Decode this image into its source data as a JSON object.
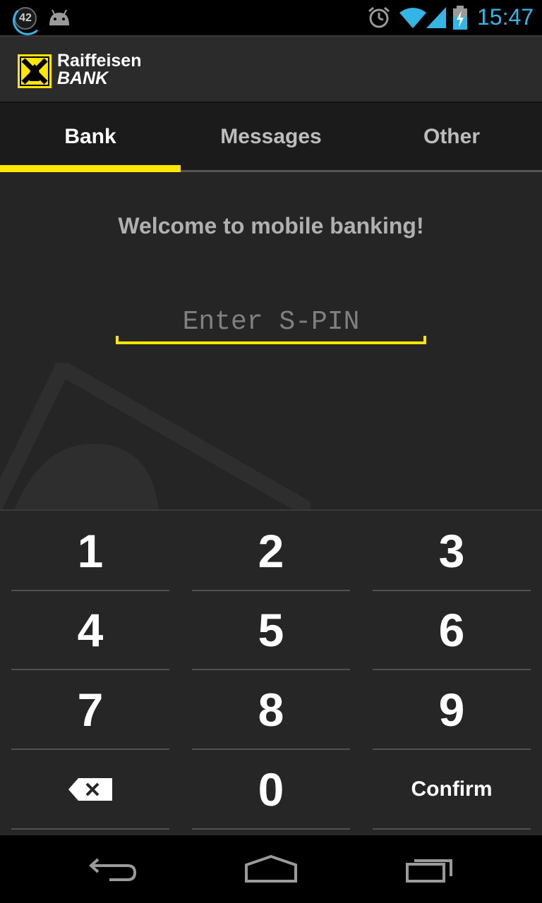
{
  "status_bar": {
    "notification_count": "42",
    "time": "15:47",
    "icons": [
      "android-icon",
      "alarm-icon",
      "wifi-icon",
      "signal-icon",
      "battery-charging-icon"
    ]
  },
  "app_bar": {
    "logo_line1": "Raiffeisen",
    "logo_line2": "BANK"
  },
  "tabs": [
    {
      "label": "Bank",
      "active": true
    },
    {
      "label": "Messages",
      "active": false
    },
    {
      "label": "Other",
      "active": false
    }
  ],
  "main": {
    "welcome": "Welcome to mobile banking!",
    "pin_placeholder": "Enter S-PIN",
    "pin_value": ""
  },
  "keypad": {
    "keys": [
      "1",
      "2",
      "3",
      "4",
      "5",
      "6",
      "7",
      "8",
      "9",
      "0"
    ],
    "confirm_label": "Confirm",
    "backspace_icon": "backspace-icon"
  },
  "nav_bar": {
    "icons": [
      "back-icon",
      "home-icon",
      "recent-apps-icon"
    ]
  },
  "colors": {
    "accent": "#ffe600",
    "status_blue": "#33b5e5",
    "background": "#252525"
  }
}
